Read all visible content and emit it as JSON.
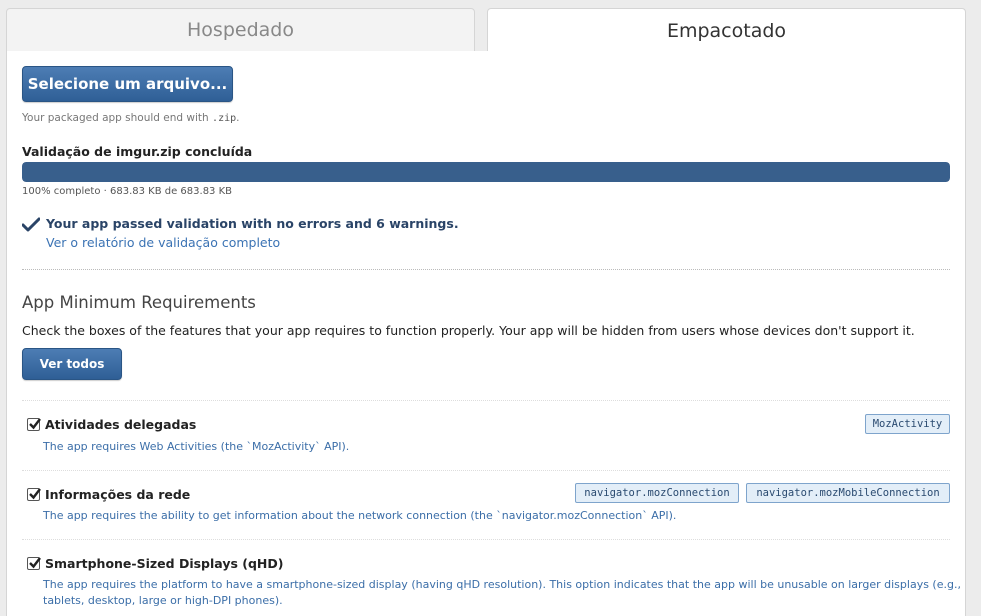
{
  "tabs": {
    "hosted": "Hospedado",
    "packaged": "Empacotado"
  },
  "upload": {
    "button_label": "Selecione um arquivo...",
    "hint_prefix": "Your packaged app should end with ",
    "hint_ext": ".zip",
    "hint_suffix": "."
  },
  "validation": {
    "title": "Validação de imgur.zip concluída",
    "progress_fraction": 1.0,
    "progress_text": "100% completo · 683.83 KB de 683.83 KB",
    "result": "Your app passed validation with no errors and 6 warnings.",
    "report_link": "Ver o relatório de validação completo"
  },
  "requirements": {
    "title": "App Minimum Requirements",
    "description": "Check the boxes of the features that your app requires to function properly. Your app will be hidden from users whose devices don't support it.",
    "show_all_label": "Ver todos",
    "features": [
      {
        "name": "Atividades delegadas",
        "description": "The app requires Web Activities (the `MozActivity` API).",
        "checked": true,
        "tags": [
          "MozActivity"
        ]
      },
      {
        "name": "Informações da rede",
        "description": "The app requires the ability to get information about the network connection (the `navigator.mozConnection` API).",
        "checked": true,
        "tags": [
          "navigator.mozConnection",
          "navigator.mozMobileConnection"
        ]
      },
      {
        "name": "Smartphone-Sized Displays (qHD)",
        "description": "The app requires the platform to have a smartphone-sized display (having qHD resolution). This option indicates that the app will be unusable on larger displays (e.g., tablets, desktop, large or high-DPI phones).",
        "checked": true,
        "tags": []
      }
    ]
  },
  "colors": {
    "accent": "#385f8c",
    "link": "#3b73b4"
  }
}
